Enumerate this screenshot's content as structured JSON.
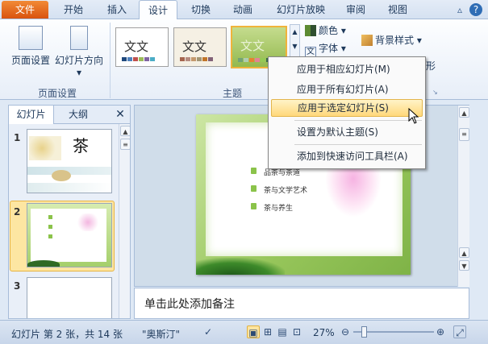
{
  "tabs": [
    {
      "label": "文件",
      "kind": "file"
    },
    {
      "label": "开始"
    },
    {
      "label": "插入"
    },
    {
      "label": "设计",
      "active": true
    },
    {
      "label": "切换"
    },
    {
      "label": "动画"
    },
    {
      "label": "幻灯片放映"
    },
    {
      "label": "审阅"
    },
    {
      "label": "视图"
    }
  ],
  "ribbon": {
    "page_setup_group": {
      "label": "页面设置",
      "page_setup_btn": "页面设置",
      "orientation_btn": "幻灯片方向",
      "orientation_arrow": "▾"
    },
    "themes_group": {
      "label": "主题",
      "theme_text": "文文"
    },
    "colors_btn": "颜色",
    "fonts_btn": "字体",
    "background_style_btn": "背景样式",
    "background_partial": "形"
  },
  "theme_menu": {
    "items": [
      {
        "label": "应用于相应幻灯片(M)"
      },
      {
        "label": "应用于所有幻灯片(A)"
      },
      {
        "label": "应用于选定幻灯片(S)",
        "hover": true
      },
      {
        "label": "设置为默认主题(S)"
      },
      {
        "label": "添加到快速访问工具栏(A)"
      }
    ]
  },
  "left_panel": {
    "tab_slides": "幻灯片",
    "tab_outline": "大纲",
    "close": "✕",
    "slide_numbers": [
      "1",
      "2",
      "3"
    ],
    "thumb1_title": "茶"
  },
  "slide": {
    "bullets": [
      "品茶与茶道",
      "茶与文学艺术",
      "茶与养生"
    ]
  },
  "notes_placeholder": "单击此处添加备注",
  "status": {
    "slide_info": "幻灯片 第 2 张，共 14 张",
    "theme_name": "\"奥斯汀\"",
    "zoom": "27%"
  },
  "colors": {
    "accent_file_tab": "#e8681f",
    "menu_highlight": "#ffd87b",
    "slide_green": "#8bc34a"
  }
}
